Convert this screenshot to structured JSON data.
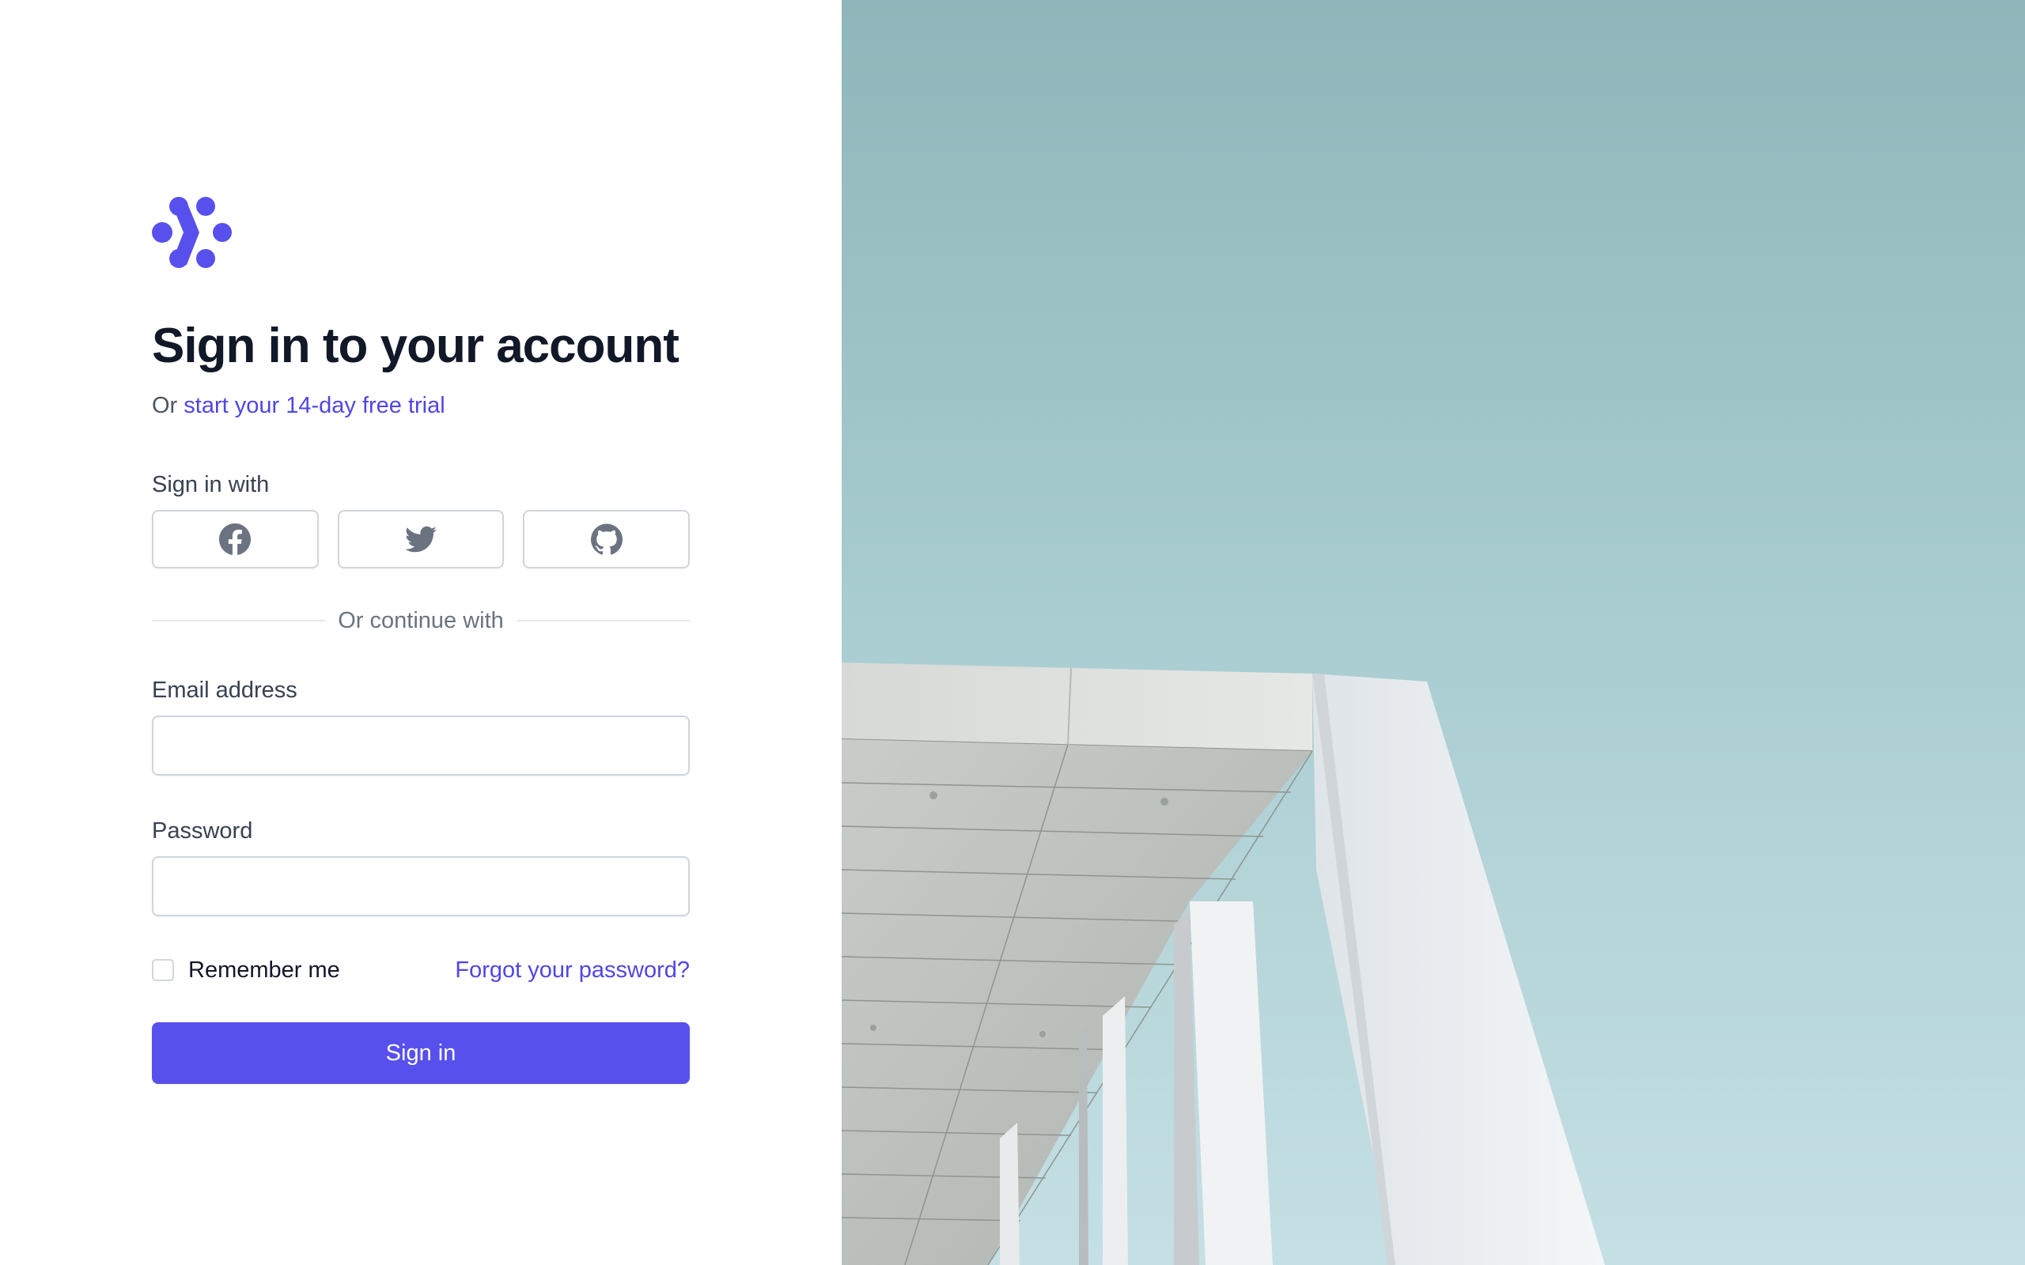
{
  "brand": {
    "logo_icon": "workflow-logo-icon",
    "accent_color": "#5850ec"
  },
  "header": {
    "title": "Sign in to your account",
    "subtitle_prefix": "Or",
    "trial_link": "start your 14-day free trial"
  },
  "social": {
    "label": "Sign in with",
    "providers": [
      {
        "name": "Facebook",
        "icon": "facebook-icon"
      },
      {
        "name": "Twitter",
        "icon": "twitter-icon"
      },
      {
        "name": "GitHub",
        "icon": "github-icon"
      }
    ],
    "divider_text": "Or continue with"
  },
  "form": {
    "email": {
      "label": "Email address",
      "value": "",
      "placeholder": ""
    },
    "password": {
      "label": "Password",
      "value": "",
      "placeholder": ""
    },
    "remember_label": "Remember me",
    "remember_checked": false,
    "forgot_label": "Forgot your password?",
    "submit_label": "Sign in"
  },
  "hero_image": {
    "subject": "white-building-against-sky-image"
  }
}
